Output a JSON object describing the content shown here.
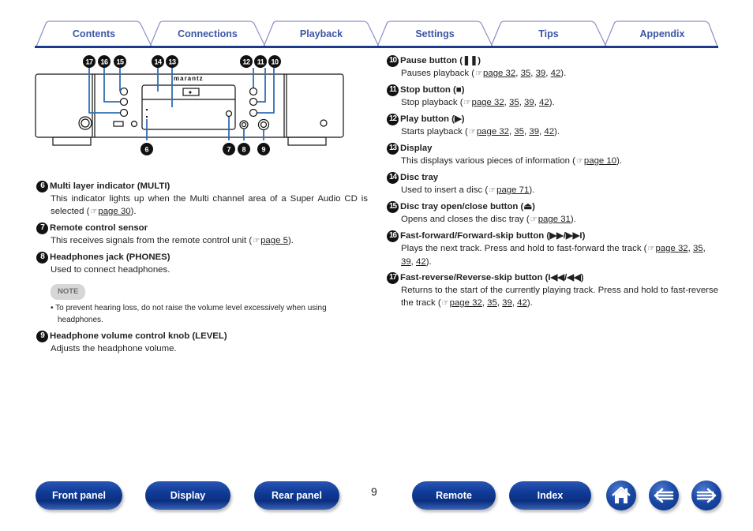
{
  "tabs": [
    {
      "label": "Contents"
    },
    {
      "label": "Connections"
    },
    {
      "label": "Playback"
    },
    {
      "label": "Settings"
    },
    {
      "label": "Tips"
    },
    {
      "label": "Appendix"
    }
  ],
  "diagram": {
    "brand": "marantz",
    "callouts_top": [
      "17",
      "16",
      "15",
      "14",
      "13",
      "12",
      "11",
      "10"
    ],
    "callouts_bottom": [
      "6",
      "7",
      "8",
      "9"
    ]
  },
  "left_items": [
    {
      "num": "6",
      "title": "Multi layer indicator (MULTI)",
      "text": "This indicator lights up when the Multi channel area of a Super Audio CD is selected (",
      "links": [
        "page 30"
      ],
      "tail": ")."
    },
    {
      "num": "7",
      "title": "Remote control sensor",
      "text": "This receives signals from the remote control unit (",
      "links": [
        "page 5"
      ],
      "tail": ")."
    },
    {
      "num": "8",
      "title": "Headphones jack (PHONES)",
      "text": "Used to connect headphones.",
      "links": [],
      "tail": ""
    },
    {
      "num": "9",
      "title": "Headphone volume control knob (LEVEL)",
      "text": "Adjusts the headphone volume.",
      "links": [],
      "tail": ""
    }
  ],
  "note": {
    "label": "NOTE",
    "bullet": "To prevent hearing loss, do not raise the volume level excessively when using headphones."
  },
  "right_items": [
    {
      "num": "10",
      "title": "Pause button (❚❚)",
      "text": "Pauses playback (",
      "links": [
        "page 32",
        "35",
        "39",
        "42"
      ],
      "tail": ")."
    },
    {
      "num": "11",
      "title": "Stop button (■)",
      "text": "Stop playback (",
      "links": [
        "page 32",
        "35",
        "39",
        "42"
      ],
      "tail": ")."
    },
    {
      "num": "12",
      "title": "Play button (▶)",
      "text": "Starts playback (",
      "links": [
        "page 32",
        "35",
        "39",
        "42"
      ],
      "tail": ")."
    },
    {
      "num": "13",
      "title": "Display",
      "text": "This displays various pieces of information (",
      "links": [
        "page 10"
      ],
      "tail": ")."
    },
    {
      "num": "14",
      "title": "Disc tray",
      "text": "Used to insert a disc (",
      "links": [
        "page 71"
      ],
      "tail": ")."
    },
    {
      "num": "15",
      "title": "Disc tray open/close button (⏏)",
      "text": "Opens and closes the disc tray (",
      "links": [
        "page 31"
      ],
      "tail": ")."
    },
    {
      "num": "16",
      "title": "Fast-forward/Forward-skip button (▶▶/▶▶I)",
      "text": "Plays the next track. Press and hold to fast-forward the track (",
      "links": [
        "page 32",
        "35",
        "39",
        "42"
      ],
      "tail": ")."
    },
    {
      "num": "17",
      "title": "Fast-reverse/Reverse-skip button (I◀◀/◀◀)",
      "text": "Returns to the start of the currently playing track. Press and hold to fast-reverse the track (",
      "links": [
        "page 32",
        "35",
        "39",
        "42"
      ],
      "tail": ")."
    }
  ],
  "ref_icon": "☞",
  "footer": {
    "front_panel": "Front panel",
    "display": "Display",
    "rear_panel": "Rear panel",
    "page_number": "9",
    "remote": "Remote",
    "index": "Index",
    "home_icon": "home-icon",
    "back_icon": "arrow-left-icon",
    "forward_icon": "arrow-right-icon"
  },
  "colors": {
    "accent": "#1b3a8c",
    "tab_text": "#3b56a5",
    "callout_line": "#2f6db5"
  }
}
